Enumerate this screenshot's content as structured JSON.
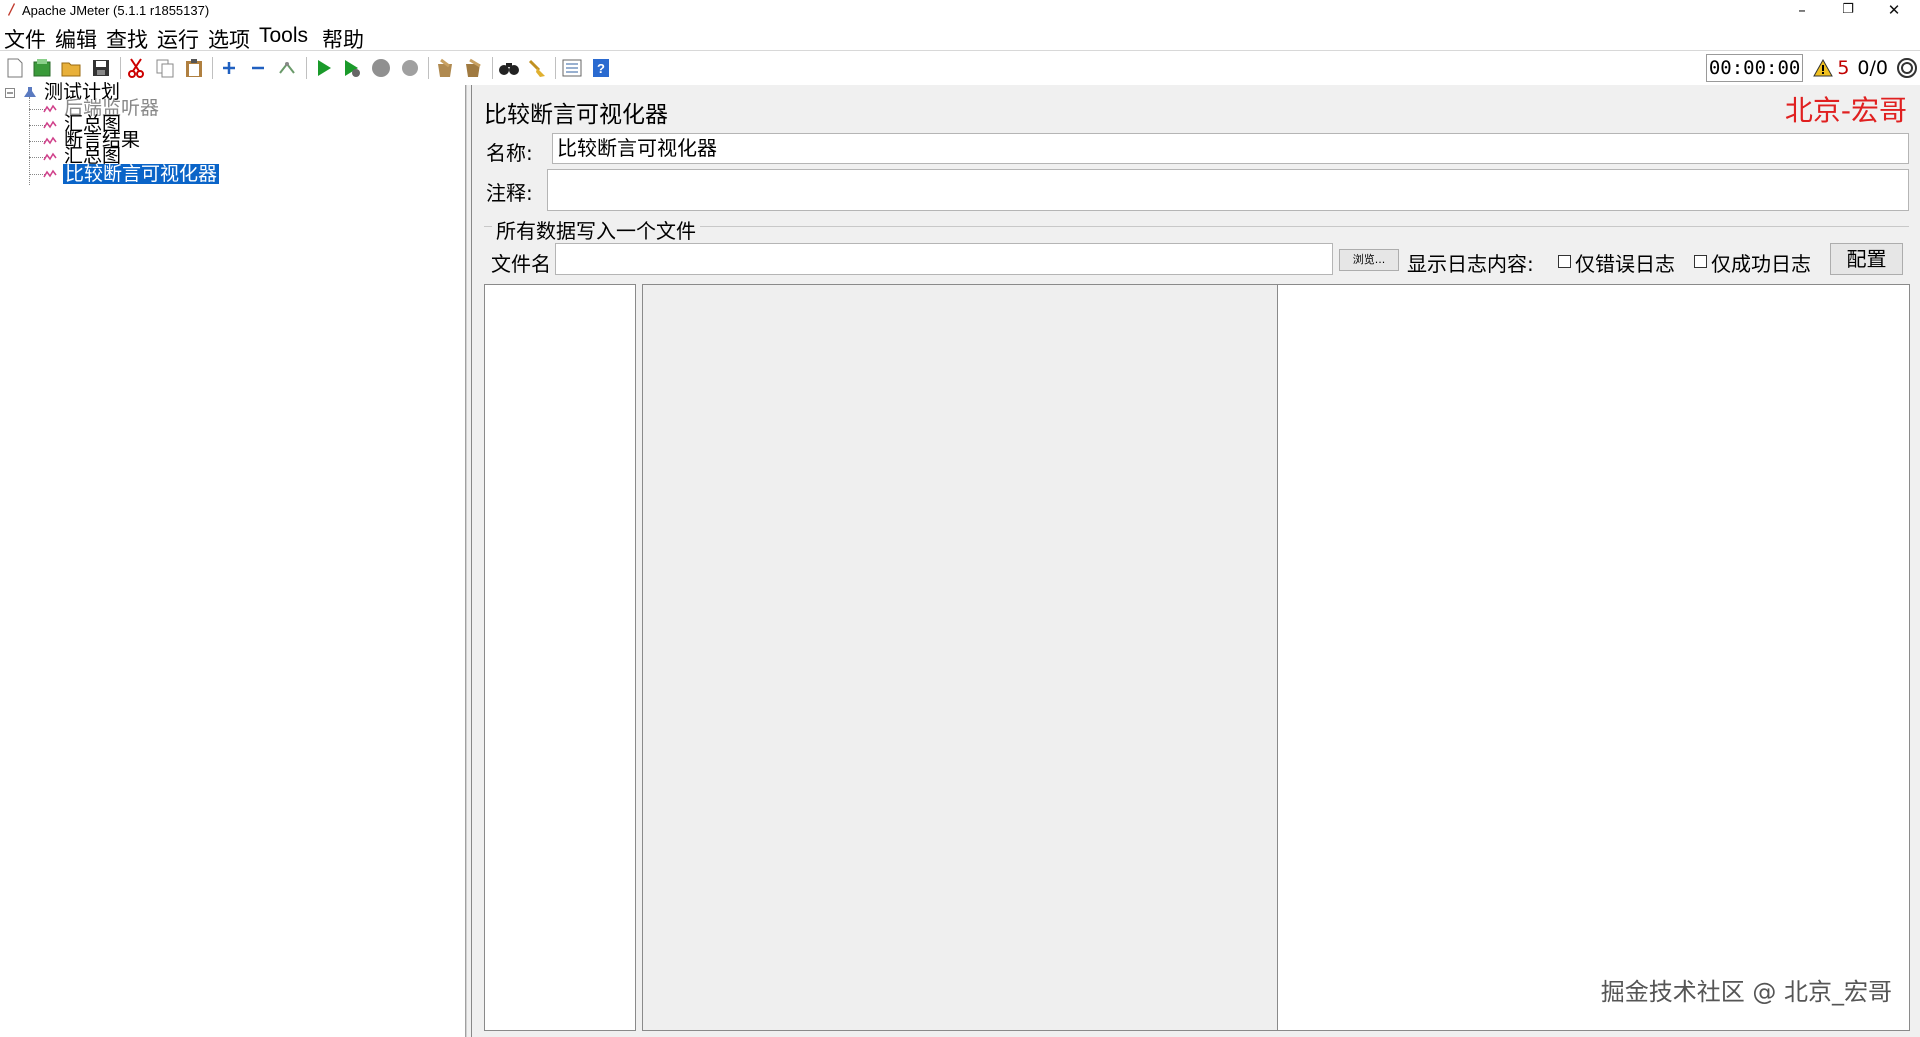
{
  "window": {
    "title": "Apache JMeter (5.1.1 r1855137)",
    "controls": {
      "minimize": "–",
      "maximize": "❐",
      "close": "✕"
    }
  },
  "menu": {
    "items": [
      "文件",
      "编辑",
      "查找",
      "运行",
      "选项",
      "Tools",
      "帮助"
    ]
  },
  "toolbar": {
    "icons": [
      "new-icon",
      "templates-icon",
      "open-icon",
      "save-icon",
      "cut-icon",
      "copy-icon",
      "paste-icon",
      "expand-icon",
      "collapse-icon",
      "toggle-icon",
      "start-icon",
      "start-no-pauses-icon",
      "stop-icon",
      "shutdown-icon",
      "clear-icon",
      "clear-all-icon",
      "search-icon",
      "reset-search-icon",
      "function-helper-icon",
      "help-icon"
    ],
    "timer": "00:00:00",
    "warning_count": "5",
    "threads": "0/0"
  },
  "tree": {
    "root": "测试计划",
    "children": [
      "后端监听器",
      "汇总图",
      "断言结果",
      "汇总图",
      "比较断言可视化器"
    ],
    "selected_index": 4
  },
  "panel": {
    "title": "比较断言可视化器",
    "brand": "北京-宏哥",
    "name_label": "名称:",
    "name_value": "比较断言可视化器",
    "comment_label": "注释:",
    "comment_value": "",
    "file_section_title": "所有数据写入一个文件",
    "filename_label": "文件名",
    "filename_value": "",
    "browse_label": "浏览...",
    "log_label": "显示日志内容:",
    "errors_only_label": "仅错误日志",
    "errors_only_checked": false,
    "success_only_label": "仅成功日志",
    "success_only_checked": false,
    "configure_label": "配置"
  },
  "watermark": "掘金技术社区 @ 北京_宏哥",
  "colors": {
    "selection": "#0a64c8",
    "brand_red": "#e02020",
    "warning_red": "#c00000",
    "start_green": "#1a9a2a"
  }
}
